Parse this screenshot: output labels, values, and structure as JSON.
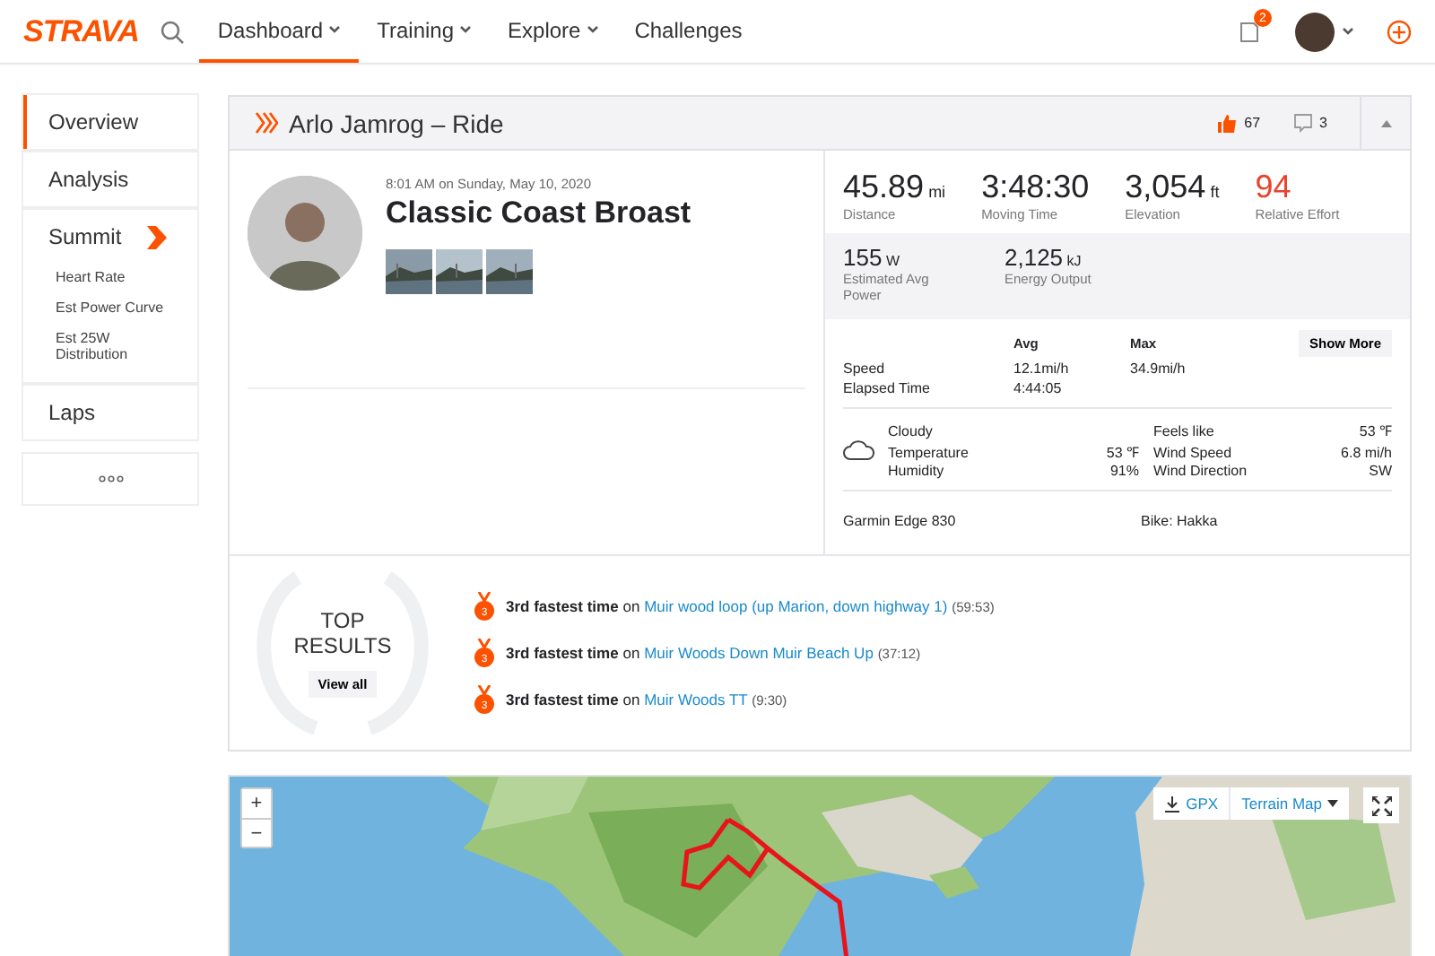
{
  "nav": {
    "logo": "STRAVA",
    "items": [
      {
        "label": "Dashboard",
        "selected": true,
        "dropdown": true
      },
      {
        "label": "Training",
        "selected": false,
        "dropdown": true
      },
      {
        "label": "Explore",
        "selected": false,
        "dropdown": true
      },
      {
        "label": "Challenges",
        "selected": false,
        "dropdown": false
      }
    ],
    "notification_count": "2"
  },
  "sidebar": {
    "items": [
      {
        "label": "Overview",
        "selected": true
      },
      {
        "label": "Analysis",
        "selected": false
      },
      {
        "label": "Summit",
        "selected": false,
        "badge": true,
        "children": [
          {
            "label": "Heart Rate"
          },
          {
            "label": "Est Power Curve"
          },
          {
            "label": "Est 25W Distribution"
          }
        ]
      },
      {
        "label": "Laps",
        "selected": false
      }
    ]
  },
  "activity": {
    "heading": "Arlo Jamrog – Ride",
    "kudos": "67",
    "comments": "3",
    "date": "8:01 AM on Sunday, May 10, 2020",
    "title": "Classic Coast Broast",
    "stats": [
      {
        "value": "45.89",
        "unit": "mi",
        "label": "Distance",
        "kind": "plain"
      },
      {
        "value": "3:48:30",
        "label": "Moving Time",
        "kind": "plain"
      },
      {
        "value": "3,054",
        "unit": "ft",
        "label": "Elevation",
        "kind": "plain"
      },
      {
        "value": "94",
        "label": "Relative Effort",
        "kind": "effort"
      }
    ],
    "power": [
      {
        "value": "155",
        "unit": "W",
        "label": "Estimated Avg Power"
      },
      {
        "value": "2,125",
        "unit": "kJ",
        "label": "Energy Output"
      }
    ],
    "table": {
      "columns": [
        "Avg",
        "Max"
      ],
      "rows": [
        {
          "label": "Speed",
          "avg": "12.1mi/h",
          "max": "34.9mi/h"
        },
        {
          "label": "Elapsed Time",
          "avg": "4:44:05"
        }
      ]
    },
    "show_more": "Show More",
    "weather": {
      "condition": "Cloudy",
      "left": [
        {
          "label": "Temperature",
          "value": "53 ℉"
        },
        {
          "label": "Humidity",
          "value": "91%"
        }
      ],
      "right": [
        {
          "label": "Feels like",
          "value": "53 ℉"
        },
        {
          "label": "Wind Speed",
          "value": "6.8 mi/h"
        },
        {
          "label": "Wind Direction",
          "value": "SW"
        }
      ]
    },
    "device": "Garmin Edge 830",
    "bike": "Bike: Hakka"
  },
  "results": {
    "title_1": "TOP",
    "title_2": "RESULTS",
    "view_all": "View all",
    "items": [
      {
        "rank": "3",
        "achievement": "3rd fastest time",
        "on": "on",
        "segment": "Muir wood loop (up Marion, down highway 1)",
        "time": "(59:53)"
      },
      {
        "rank": "3",
        "achievement": "3rd fastest time",
        "on": "on",
        "segment": "Muir Woods Down Muir Beach Up",
        "time": "(37:12)"
      },
      {
        "rank": "3",
        "achievement": "3rd fastest time",
        "on": "on",
        "segment": "Muir Woods TT",
        "time": "(9:30)"
      }
    ]
  },
  "map": {
    "zoom_in": "+",
    "zoom_out": "−",
    "gpx": "GPX",
    "map_type": "Terrain Map"
  }
}
